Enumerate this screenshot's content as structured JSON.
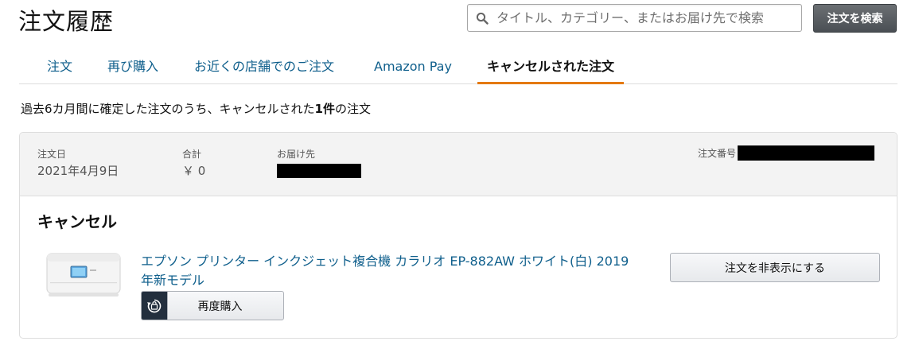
{
  "page": {
    "title": "注文履歴"
  },
  "search": {
    "placeholder": "タイトル、カテゴリー、またはお届け先で検索",
    "button_label": "注文を検索"
  },
  "tabs": [
    {
      "label": "注文",
      "active": false
    },
    {
      "label": "再び購入",
      "active": false
    },
    {
      "label": "お近くの店舗でのご注文",
      "active": false
    },
    {
      "label": "Amazon Pay",
      "active": false
    },
    {
      "label": "キャンセルされた注文",
      "active": true
    }
  ],
  "summary": {
    "prefix": "過去6カ月間に確定した注文のうち、キャンセルされた",
    "count": "1件",
    "suffix": "の注文"
  },
  "order": {
    "date_label": "注文日",
    "date": "2021年4月9日",
    "total_label": "合計",
    "total": "￥ 0",
    "ship_to_label": "お届け先",
    "order_number_label": "注文番号",
    "status": "キャンセル",
    "product": {
      "title": "エプソン プリンター インクジェット複合機 カラリオ EP-882AW ホワイト(白) 2019年新モデル"
    },
    "rebuy_label": "再度購入",
    "hide_label": "注文を非表示にする"
  },
  "colors": {
    "link": "#0f5f8c",
    "active_tab_underline": "#e47911",
    "header_bg": "#f3f3f3"
  }
}
